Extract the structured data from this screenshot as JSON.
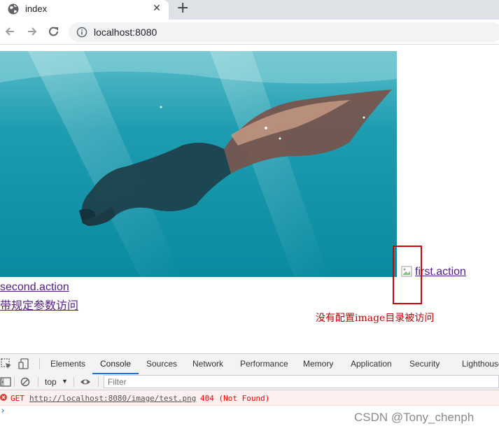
{
  "browser": {
    "tab_title": "index",
    "tab_close": "✕",
    "new_tab": "+",
    "url": "localhost:8080"
  },
  "page": {
    "photo_icon": "underwater-freediver-with-monofin-photo",
    "broken_image_icon": "broken-image-icon",
    "link_first": "first.action",
    "link_second": "second.action",
    "link_params": "带规定参数访问",
    "annotation": "没有配置image目录被访问",
    "annotation_color": "#c00000"
  },
  "devtools": {
    "tabs": [
      "Elements",
      "Console",
      "Sources",
      "Network",
      "Performance",
      "Memory",
      "Application",
      "Security",
      "Lighthouse"
    ],
    "active_tab": "Console",
    "context": "top",
    "filter_placeholder": "Filter",
    "error": {
      "method": "GET",
      "url": "http://localhost:8080/image/test.png",
      "status": "404 (Not Found)"
    },
    "prompt": "›",
    "accent_color": "#1a73e8",
    "error_color": "#ff0000"
  },
  "watermark": "CSDN @Tony_chenph"
}
